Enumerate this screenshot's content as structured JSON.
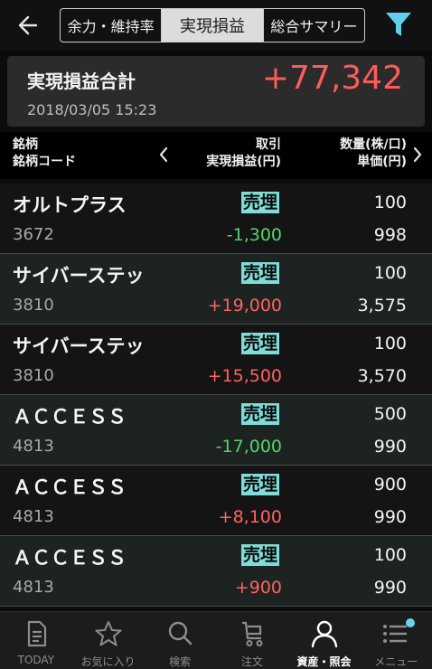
{
  "header": {
    "tabs": [
      {
        "label": "余力・維持率"
      },
      {
        "label": "実現損益"
      },
      {
        "label": "総合サマリー"
      }
    ],
    "active_tab": "実現損益"
  },
  "summary": {
    "title": "実現損益合計",
    "value": "+77,342",
    "datetime": "2018/03/05  15:23"
  },
  "columns": {
    "name_line1": "銘柄",
    "name_line2": "銘柄コード",
    "mid_line1": "取引",
    "mid_line2": "実現損益(円)",
    "right_line1": "数量(株/口)",
    "right_line2": "単価(円)"
  },
  "rows": [
    {
      "name": "オルトプラス",
      "code": "3672",
      "side": "売埋",
      "pnl": "-1,300",
      "qty": "100",
      "price": "998"
    },
    {
      "name": "サイバーステッ",
      "code": "3810",
      "side": "売埋",
      "pnl": "+19,000",
      "qty": "100",
      "price": "3,575"
    },
    {
      "name": "サイバーステッ",
      "code": "3810",
      "side": "売埋",
      "pnl": "+15,500",
      "qty": "100",
      "price": "3,570"
    },
    {
      "name": "ＡＣＣＥＳＳ",
      "code": "4813",
      "side": "売埋",
      "pnl": "-17,000",
      "qty": "500",
      "price": "990"
    },
    {
      "name": "ＡＣＣＥＳＳ",
      "code": "4813",
      "side": "売埋",
      "pnl": "+8,100",
      "qty": "900",
      "price": "990"
    },
    {
      "name": "ＡＣＣＥＳＳ",
      "code": "4813",
      "side": "売埋",
      "pnl": "+900",
      "qty": "100",
      "price": "990"
    }
  ],
  "colors": {
    "positive": "#ff6262",
    "negative": "#57d36b",
    "badge": "#7fdcd8",
    "filter_accent": "#5fd0ea"
  },
  "bottom_nav": [
    {
      "label": "TODAY",
      "icon": "document-icon"
    },
    {
      "label": "お気に入り",
      "icon": "star-icon"
    },
    {
      "label": "検索",
      "icon": "search-icon"
    },
    {
      "label": "注文",
      "icon": "cart-icon"
    },
    {
      "label": "資産・照会",
      "icon": "person-icon"
    },
    {
      "label": "メニュー",
      "icon": "menu-icon"
    }
  ],
  "active_nav": "資産・照会"
}
